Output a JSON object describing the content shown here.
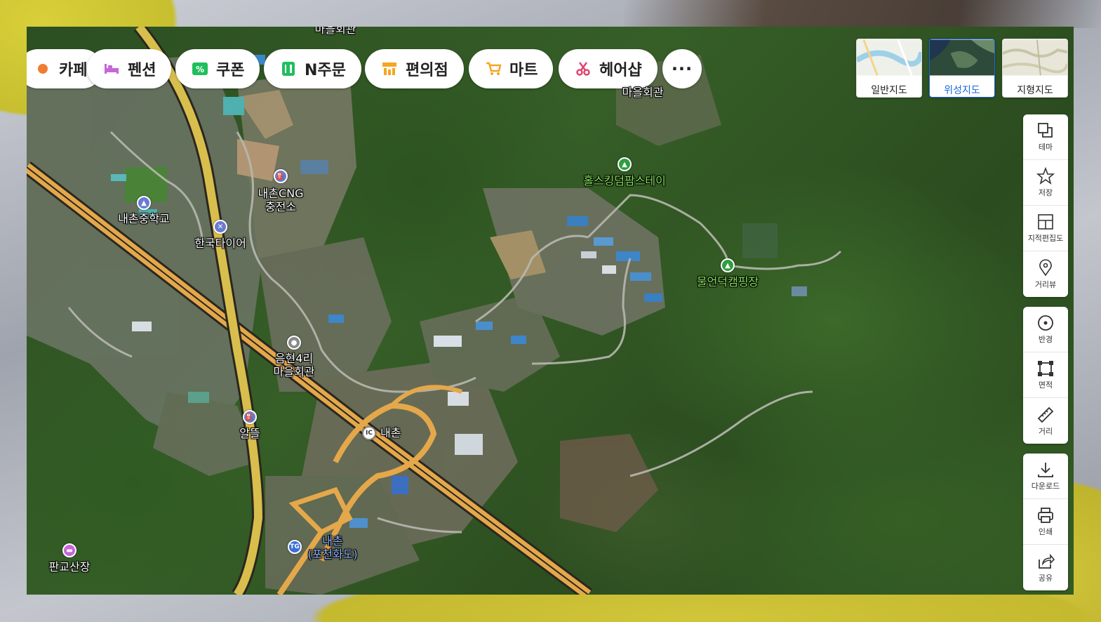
{
  "categories": [
    {
      "label": "카페",
      "icon": "cafe-icon",
      "color": "#f07d34"
    },
    {
      "label": "펜션",
      "icon": "bed-icon",
      "color": "#c666d9"
    },
    {
      "label": "쿠폰",
      "icon": "coupon-icon",
      "color": "#1fbf5c"
    },
    {
      "label": "N주문",
      "icon": "order-icon",
      "color": "#1fbf5c"
    },
    {
      "label": "편의점",
      "icon": "store-icon",
      "color": "#f5a623"
    },
    {
      "label": "마트",
      "icon": "cart-icon",
      "color": "#f5a623"
    },
    {
      "label": "헤어샵",
      "icon": "scissors-icon",
      "color": "#e0446e"
    }
  ],
  "more_label": "···",
  "map_types": [
    {
      "label": "일반지도",
      "active": false
    },
    {
      "label": "위성지도",
      "active": true
    },
    {
      "label": "지형지도",
      "active": false
    }
  ],
  "tools_group1": [
    {
      "label": "테마",
      "icon": "layers-icon"
    },
    {
      "label": "저장",
      "icon": "star-icon"
    },
    {
      "label": "지적편집도",
      "icon": "cadastral-icon"
    },
    {
      "label": "거리뷰",
      "icon": "streetview-icon"
    }
  ],
  "tools_group2": [
    {
      "label": "반경",
      "icon": "radius-icon"
    },
    {
      "label": "면적",
      "icon": "area-icon"
    },
    {
      "label": "거리",
      "icon": "ruler-icon"
    }
  ],
  "tools_group3": [
    {
      "label": "다운로드",
      "icon": "download-icon"
    },
    {
      "label": "인쇄",
      "icon": "print-icon"
    },
    {
      "label": "공유",
      "icon": "share-icon"
    }
  ],
  "places": {
    "top_partial": "마을회관",
    "village_hall_top": "마을회관",
    "camp1": "홀스킹덤팜스테이",
    "camp2": "물언덕캠핑장",
    "cng_1": "내촌CNG",
    "cng_2": "충전소",
    "school": "내촌중학교",
    "tire": "한국타이어",
    "hall_1": "음현4리",
    "hall_2": "마을회관",
    "ic": "내촌",
    "ic_badge": "IC",
    "store": "알뜰",
    "tg_1": "내촌",
    "tg_2": "(포천화도)",
    "tg_badge": "TG",
    "mountain": "판교산장"
  }
}
